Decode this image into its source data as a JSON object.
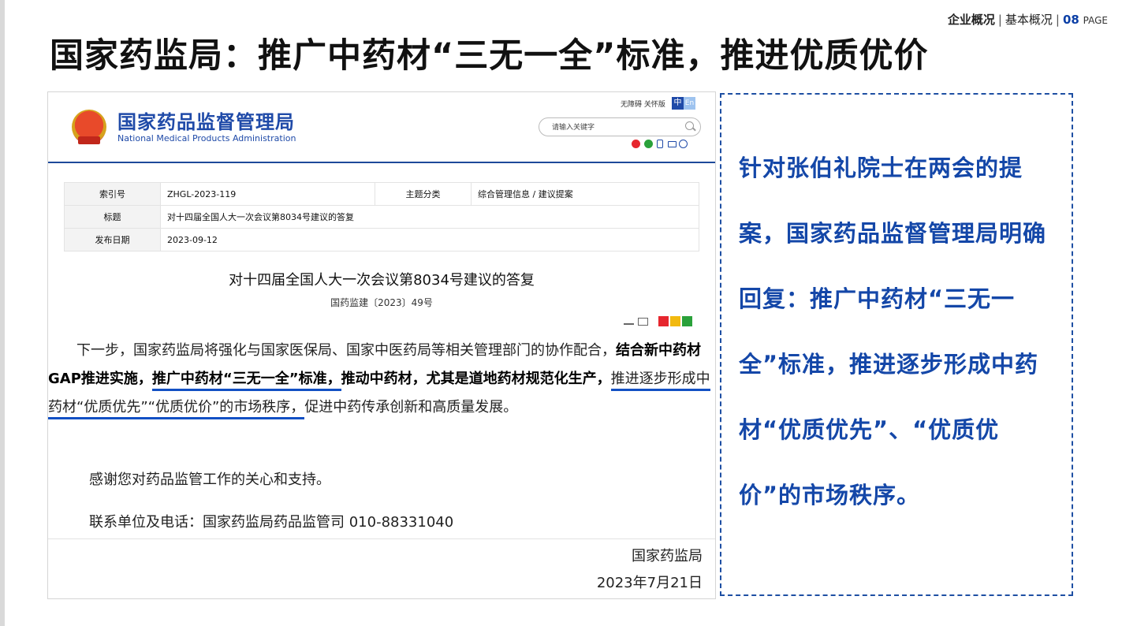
{
  "breadcrumb": {
    "section": "企业概况",
    "sub": "基本概况",
    "page_num": "08",
    "page_word": "PAGE"
  },
  "title": "国家药监局：推广中药材“三无一全”标准，推进优质优价",
  "screenshot": {
    "site_name": "国家药品监督管理局",
    "site_name_en": "National Medical Products Administration",
    "top_links": "无障碍 关怀版",
    "lang_zh": "中",
    "lang_en": "En",
    "search_placeholder": "请输入关键字",
    "meta": {
      "index_label": "索引号",
      "index_value": "ZHGL-2023-119",
      "category_label": "主题分类",
      "category_value": "综合管理信息 / 建议提案",
      "title_label": "标题",
      "title_value": "对十四届全国人大一次会议第8034号建议的答复",
      "date_label": "发布日期",
      "date_value": "2023-09-12"
    },
    "doc_title": "对十四届全国人大一次会议第8034号建议的答复",
    "doc_number": "国药监建〔2023〕49号",
    "body": {
      "p1_a": "下一步，国家药监局将强化与国家医保局、国家中医药局等相关管理部门的协作配合，",
      "p1_b": "结合新中药材GAP推进实施，",
      "p1_c": "推广中药材“三无一全”标准，",
      "p1_d": "推动中药材，尤其是道地药材规范化生产，",
      "p1_e": "推进逐步形成中药材“优质优先”“优质优价”的市场秩序，",
      "p1_f": "促进中药传承创新和高质量发展。",
      "p2": "感谢您对药品监管工作的关心和支持。",
      "p3": "联系单位及电话：国家药监局药品监管司 010-88331040",
      "signer": "国家药监局",
      "sign_date": "2023年7月21日"
    }
  },
  "callout": {
    "text": "针对张伯礼院士在两会的提案，国家药品监督管理局明确回复：推广中药材“三无一全”标准，推进逐步形成中药材“优质优先”、“优质优价”的市场秩序。"
  }
}
